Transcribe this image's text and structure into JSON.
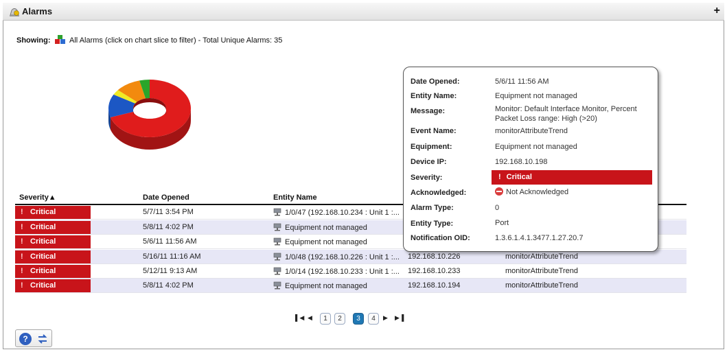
{
  "window": {
    "title": "Alarms",
    "expand_symbol": "+"
  },
  "filter": {
    "prefix": "Showing:",
    "text": "All Alarms (click on chart slice to filter) - Total Unique Alarms: 35"
  },
  "chart_data": {
    "type": "pie",
    "style": "3d-donut",
    "slices": [
      {
        "color": "#e01c1c",
        "value": 0.7
      },
      {
        "color": "#1c57c4",
        "value": 0.13
      },
      {
        "color": "#f0ea24",
        "value": 0.03
      },
      {
        "color": "#f28a0e",
        "value": 0.1
      },
      {
        "color": "#2aa52a",
        "value": 0.04
      }
    ]
  },
  "table": {
    "columns": [
      "Severity▲",
      "Date Opened",
      "Entity Name"
    ],
    "rows": [
      {
        "severity": "Critical",
        "date": "5/7/11 3:54 PM",
        "entity": "1/0/47 (192.168.10.234 : Unit 1 :...",
        "device_ip": "",
        "event": ""
      },
      {
        "severity": "Critical",
        "date": "5/8/11 4:02 PM",
        "entity": "Equipment not managed",
        "device_ip": "",
        "event": ""
      },
      {
        "severity": "Critical",
        "date": "5/6/11 11:56 AM",
        "entity": "Equipment not managed",
        "device_ip": "",
        "event": ""
      },
      {
        "severity": "Critical",
        "date": "5/16/11 11:16 AM",
        "entity": "1/0/48 (192.168.10.226 : Unit 1 :...",
        "device_ip": "192.168.10.226",
        "event": "monitorAttributeTrend"
      },
      {
        "severity": "Critical",
        "date": "5/12/11 9:13 AM",
        "entity": "1/0/14 (192.168.10.233 : Unit 1 :...",
        "device_ip": "192.168.10.233",
        "event": "monitorAttributeTrend"
      },
      {
        "severity": "Critical",
        "date": "5/8/11 4:02 PM",
        "entity": "Equipment not managed",
        "device_ip": "192.168.10.194",
        "event": "monitorAttributeTrend"
      }
    ]
  },
  "pager": {
    "pages": [
      "1",
      "2",
      "3",
      "4"
    ],
    "current": "3"
  },
  "toolbar": {
    "help_label": "?"
  },
  "tooltip": {
    "fields": [
      {
        "label": "Date Opened:",
        "value": "5/6/11 11:56 AM"
      },
      {
        "label": "Entity Name:",
        "value": "Equipment not managed"
      },
      {
        "label": "Message:",
        "value": "Monitor: Default Interface Monitor, Percent Packet Loss range: High (>20)"
      },
      {
        "label": "Event Name:",
        "value": "monitorAttributeTrend"
      },
      {
        "label": "Equipment:",
        "value": "Equipment not managed"
      },
      {
        "label": "Device IP:",
        "value": "192.168.10.198"
      },
      {
        "label": "Severity:",
        "value": "Critical"
      },
      {
        "label": "Acknowledged:",
        "value": "Not Acknowledged"
      },
      {
        "label": "Alarm Type:",
        "value": "0"
      },
      {
        "label": "Entity Type:",
        "value": "Port"
      },
      {
        "label": "Notification OID:",
        "value": "1.3.6.1.4.1.3477.1.27.20.7"
      }
    ]
  },
  "colors": {
    "critical": "#c8141a",
    "row_alt": "#e7e7f6",
    "page_active": "#1f78b4"
  }
}
